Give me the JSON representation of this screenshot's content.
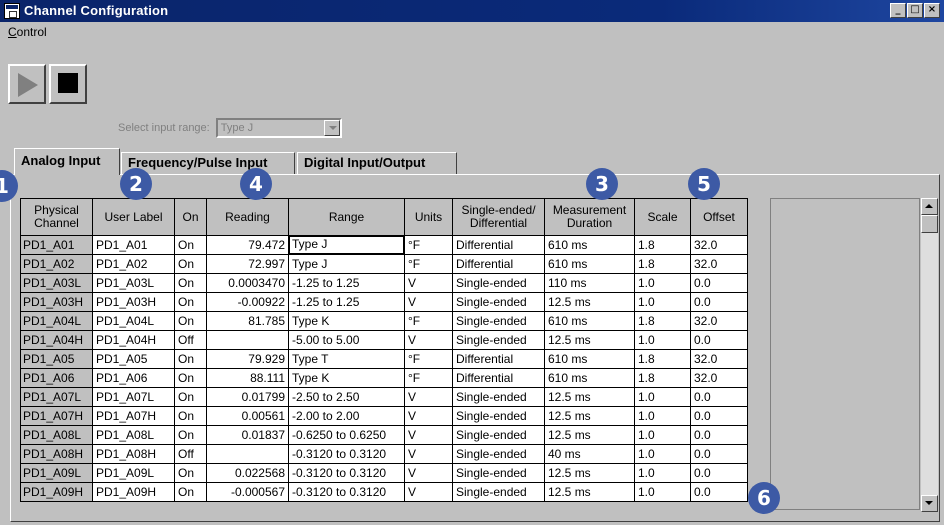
{
  "window": {
    "title": "Channel Configuration",
    "controls": [
      "_",
      "□",
      "×"
    ]
  },
  "menu": {
    "items": [
      {
        "label": "Control"
      }
    ]
  },
  "toolbar": {
    "play_icon": "play-icon",
    "stop_icon": "stop-icon"
  },
  "input_range": {
    "label": "Select input range:",
    "value": "Type J",
    "enabled": false
  },
  "tabs": [
    {
      "label": "Analog Input",
      "active": true
    },
    {
      "label": "Frequency/Pulse Input",
      "active": false
    },
    {
      "label": "Digital Input/Output",
      "active": false
    }
  ],
  "table": {
    "headers": [
      "Physical Channel",
      "User Label",
      "On",
      "Reading",
      "Range",
      "Units",
      "Single-ended/ Differential",
      "Measurement Duration",
      "Scale",
      "Offset"
    ],
    "rows": [
      {
        "physical": "PD1_A01",
        "label": "PD1_A01",
        "on": "On",
        "reading": "79.472",
        "range": "Type J",
        "units": "°F",
        "mode": "Differential",
        "duration": "610 ms",
        "scale": "1.8",
        "offset": "32.0"
      },
      {
        "physical": "PD1_A02",
        "label": "PD1_A02",
        "on": "On",
        "reading": "72.997",
        "range": "Type J",
        "units": "°F",
        "mode": "Differential",
        "duration": "610 ms",
        "scale": "1.8",
        "offset": "32.0"
      },
      {
        "physical": "PD1_A03L",
        "label": "PD1_A03L",
        "on": "On",
        "reading": "0.0003470",
        "range": "-1.25 to 1.25",
        "units": "V",
        "mode": "Single-ended",
        "duration": "110 ms",
        "scale": "1.0",
        "offset": "0.0"
      },
      {
        "physical": "PD1_A03H",
        "label": "PD1_A03H",
        "on": "On",
        "reading": "-0.00922",
        "range": "-1.25 to 1.25",
        "units": "V",
        "mode": "Single-ended",
        "duration": "12.5 ms",
        "scale": "1.0",
        "offset": "0.0"
      },
      {
        "physical": "PD1_A04L",
        "label": "PD1_A04L",
        "on": "On",
        "reading": "81.785",
        "range": "Type K",
        "units": "°F",
        "mode": "Single-ended",
        "duration": "610 ms",
        "scale": "1.8",
        "offset": "32.0"
      },
      {
        "physical": "PD1_A04H",
        "label": "PD1_A04H",
        "on": "Off",
        "reading": "",
        "range": "-5.00 to 5.00",
        "units": "V",
        "mode": "Single-ended",
        "duration": "12.5 ms",
        "scale": "1.0",
        "offset": "0.0"
      },
      {
        "physical": "PD1_A05",
        "label": "PD1_A05",
        "on": "On",
        "reading": "79.929",
        "range": "Type T",
        "units": "°F",
        "mode": "Differential",
        "duration": "610 ms",
        "scale": "1.8",
        "offset": "32.0"
      },
      {
        "physical": "PD1_A06",
        "label": "PD1_A06",
        "on": "On",
        "reading": "88.111",
        "range": "Type K",
        "units": "°F",
        "mode": "Differential",
        "duration": "610 ms",
        "scale": "1.8",
        "offset": "32.0"
      },
      {
        "physical": "PD1_A07L",
        "label": "PD1_A07L",
        "on": "On",
        "reading": "0.01799",
        "range": "-2.50 to 2.50",
        "units": "V",
        "mode": "Single-ended",
        "duration": "12.5 ms",
        "scale": "1.0",
        "offset": "0.0"
      },
      {
        "physical": "PD1_A07H",
        "label": "PD1_A07H",
        "on": "On",
        "reading": "0.00561",
        "range": "-2.00 to 2.00",
        "units": "V",
        "mode": "Single-ended",
        "duration": "12.5 ms",
        "scale": "1.0",
        "offset": "0.0"
      },
      {
        "physical": "PD1_A08L",
        "label": "PD1_A08L",
        "on": "On",
        "reading": "0.01837",
        "range": "-0.6250 to 0.6250",
        "units": "V",
        "mode": "Single-ended",
        "duration": "12.5 ms",
        "scale": "1.0",
        "offset": "0.0"
      },
      {
        "physical": "PD1_A08H",
        "label": "PD1_A08H",
        "on": "Off",
        "reading": "",
        "range": "-0.3120 to 0.3120",
        "units": "V",
        "mode": "Single-ended",
        "duration": "40 ms",
        "scale": "1.0",
        "offset": "0.0"
      },
      {
        "physical": "PD1_A09L",
        "label": "PD1_A09L",
        "on": "On",
        "reading": "0.022568",
        "range": "-0.3120 to 0.3120",
        "units": "V",
        "mode": "Single-ended",
        "duration": "12.5 ms",
        "scale": "1.0",
        "offset": "0.0"
      },
      {
        "physical": "PD1_A09H",
        "label": "PD1_A09H",
        "on": "On",
        "reading": "-0.000567",
        "range": "-0.3120 to 0.3120",
        "units": "V",
        "mode": "Single-ended",
        "duration": "12.5 ms",
        "scale": "1.0",
        "offset": "0.0"
      }
    ]
  },
  "callouts": [
    "1",
    "2",
    "3",
    "4",
    "5",
    "6"
  ],
  "colors": {
    "titlebar": "#0a246a",
    "callout": "#3d5aa5",
    "face": "#c0c0c0"
  }
}
